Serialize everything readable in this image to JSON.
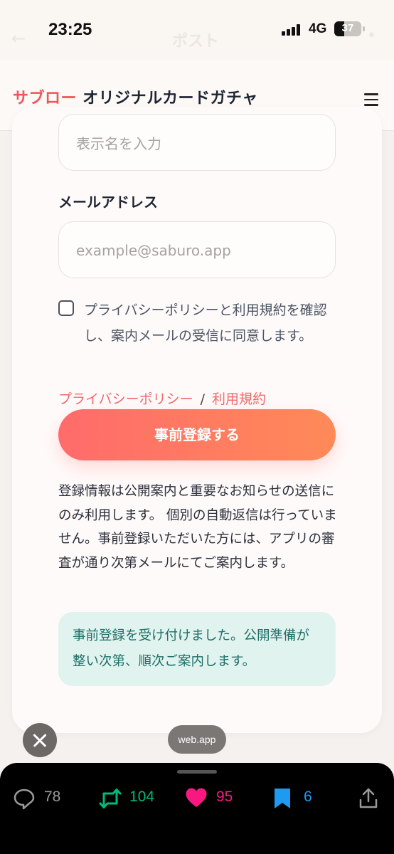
{
  "status_bar": {
    "time": "23:25",
    "network": "4G",
    "battery": "37",
    "battery_level_percent": 37,
    "underlying_title": "ポスト"
  },
  "header": {
    "brand_accent": "サブロー",
    "brand_rest": " オリジナルカードガチャ",
    "accent_color": "#f0555a"
  },
  "form": {
    "display_name_placeholder": "表示名を入力",
    "email_label": "メールアドレス",
    "email_placeholder": "example@saburo.app",
    "consent_checked": false,
    "consent_text": "プライバシーポリシーと利用規約を確認し、案内メールの受信に同意します。",
    "privacy_link": "プライバシーポリシー",
    "separator": "/",
    "terms_link": "利用規約",
    "submit_label": "事前登録する",
    "notice": "登録情報は公開案内と重要なお知らせの送信にのみ利用します。 個別の自動返信は行っていません。事前登録いただいた方には、アプリの審査が通り次第メールにてご案内します。",
    "success_message": "事前登録を受け付けました。公開準備が整い次第、順次ご案内します。"
  },
  "overlay": {
    "url_label": "web.app",
    "close_icon": "close-icon"
  },
  "actions": {
    "replies": "78",
    "reposts": "104",
    "likes": "95",
    "bookmarks": "6",
    "colors": {
      "reply": "#9a9a9a",
      "repost": "#00ba7c",
      "like": "#f91880",
      "bookmark": "#1d9bf0"
    }
  }
}
